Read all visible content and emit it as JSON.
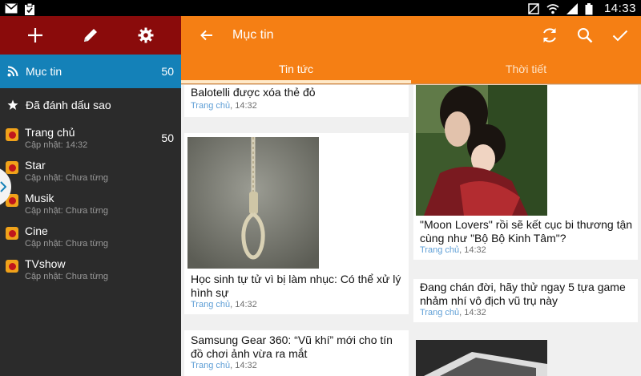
{
  "status_bar": {
    "time": "14:33",
    "left_icons": [
      "mail-icon",
      "clipboard-icon"
    ],
    "right_icons": [
      "mute-icon",
      "wifi-icon",
      "signal-icon",
      "battery-icon"
    ]
  },
  "sidebar": {
    "toolbar_icons": [
      "plus-icon",
      "pencil-icon",
      "gear-icon"
    ],
    "items": [
      {
        "label": "Mục tin",
        "count": "50",
        "icon": "rss-icon",
        "active": true
      },
      {
        "label": "Đã đánh dấu sao",
        "count": "",
        "icon": "star-icon",
        "active": false
      }
    ],
    "feeds": [
      {
        "title": "Trang chủ",
        "subtitle": "Cập nhật: 14:32",
        "count": "50"
      },
      {
        "title": "Star",
        "subtitle": "Cập nhật: Chưa từng",
        "count": ""
      },
      {
        "title": "Musik",
        "subtitle": "Cập nhật: Chưa từng",
        "count": ""
      },
      {
        "title": "Cine",
        "subtitle": "Cập nhật: Chưa từng",
        "count": ""
      },
      {
        "title": "TVshow",
        "subtitle": "Cập nhật: Chưa từng",
        "count": ""
      }
    ]
  },
  "appbar": {
    "title": "Mục tin",
    "actions": [
      "refresh-icon",
      "search-icon",
      "check-icon"
    ]
  },
  "tabs": [
    {
      "label": "Tin tức",
      "active": true
    },
    {
      "label": "Thời tiết",
      "active": false
    }
  ],
  "articles": {
    "left": [
      {
        "headline": "Balotelli được xóa thẻ đỏ",
        "source": "Trang chủ",
        "time": ", 14:32"
      },
      {
        "headline": "Học sinh tự tử vì bị làm nhục: Có thể xử lý hình sự",
        "source": "Trang chủ",
        "time": ", 14:32"
      },
      {
        "headline": "Samsung Gear 360: “Vũ khí” mới cho tín đồ chơi ảnh vừa ra mắt",
        "source": "Trang chủ",
        "time": ", 14:32"
      }
    ],
    "right": [
      {
        "headline": "\"Moon Lovers\" rồi sẽ kết cục bi thương tận cùng như \"Bộ Bộ Kinh Tâm\"?",
        "source": "Trang chủ",
        "time": ", 14:32"
      },
      {
        "headline": "Đang chán đời, hãy thử ngay 5 tựa game nhảm nhí vô địch vũ trụ này",
        "source": "Trang chủ",
        "time": ", 14:32"
      }
    ]
  },
  "colors": {
    "accent": "#f57f14",
    "sidebar_toolbar": "#8a0b0b",
    "sidebar_active": "#1481b8",
    "sidebar_bg": "#2b2b2b",
    "source_link": "#5f9fd6"
  }
}
